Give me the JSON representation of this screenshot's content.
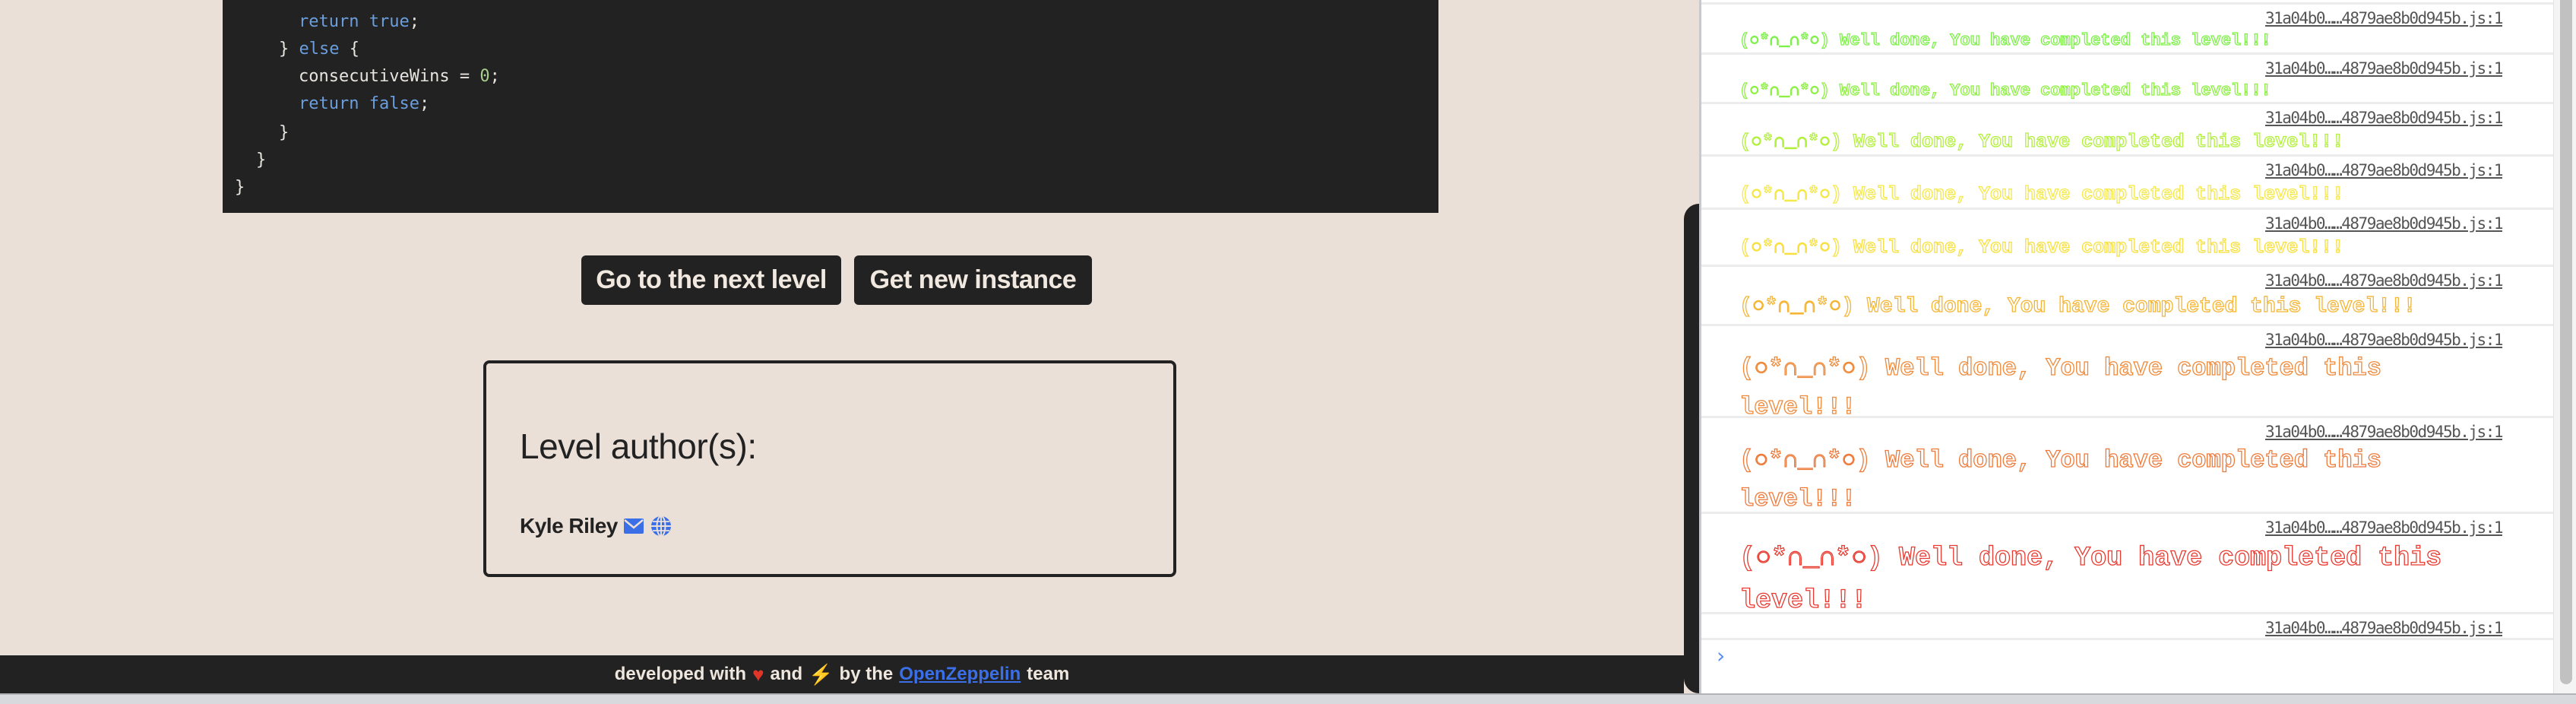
{
  "code": {
    "lines": [
      {
        "indent": 2,
        "parts": [
          {
            "t": "return true",
            "c": "kw"
          },
          {
            "t": ";",
            "c": ""
          }
        ]
      },
      {
        "indent": 1,
        "parts": [
          {
            "t": "} ",
            "c": ""
          },
          {
            "t": "else",
            "c": "kw"
          },
          {
            "t": " {",
            "c": ""
          }
        ]
      },
      {
        "indent": 2,
        "parts": [
          {
            "t": "consecutiveWins = ",
            "c": ""
          },
          {
            "t": "0",
            "c": "num"
          },
          {
            "t": ";",
            "c": ""
          }
        ]
      },
      {
        "indent": 2,
        "parts": [
          {
            "t": "return false",
            "c": "kw"
          },
          {
            "t": ";",
            "c": ""
          }
        ]
      },
      {
        "indent": 1,
        "parts": [
          {
            "t": "}",
            "c": ""
          }
        ]
      },
      {
        "indent": 0.5,
        "parts": [
          {
            "t": "}",
            "c": ""
          }
        ]
      },
      {
        "indent": 0,
        "parts": [
          {
            "t": "}",
            "c": ""
          }
        ]
      }
    ]
  },
  "buttons": {
    "next_level": "Go to the next level",
    "new_instance": "Get new instance"
  },
  "author_card": {
    "title": "Level author(s):",
    "name": "Kyle Riley",
    "icons": [
      "email-icon",
      "globe-icon"
    ]
  },
  "footer": {
    "prefix": "developed with",
    "and": "and",
    "by_the": "by the",
    "link": "OpenZeppelin",
    "suffix": "team",
    "heart_color": "#e0362a",
    "bolt_color": "#f5e63a",
    "link_color": "#3b6fe8"
  },
  "console": {
    "source": "31a04b0……4879ae8b0d945b.js:1",
    "message": "(○*∩_∩*○) Well done, You have completed this level!!!",
    "entries": [
      {
        "color": "#7ef04a",
        "size": "small"
      },
      {
        "color": "#8ef044",
        "size": "small"
      },
      {
        "color": "#b2f03c",
        "size": "medium"
      },
      {
        "color": "#f5e84a",
        "size": "medium"
      },
      {
        "color": "#f8e040",
        "size": "medium"
      },
      {
        "color": "#f5b535",
        "size": "large"
      },
      {
        "color": "#ef8a3a",
        "size": "xlarge"
      },
      {
        "color": "#ee7a3a",
        "size": "xlarge"
      },
      {
        "color": "#e83a30",
        "size": "xxlarge"
      },
      {
        "color": null,
        "size": "none"
      }
    ],
    "prompt_symbol": "›"
  }
}
